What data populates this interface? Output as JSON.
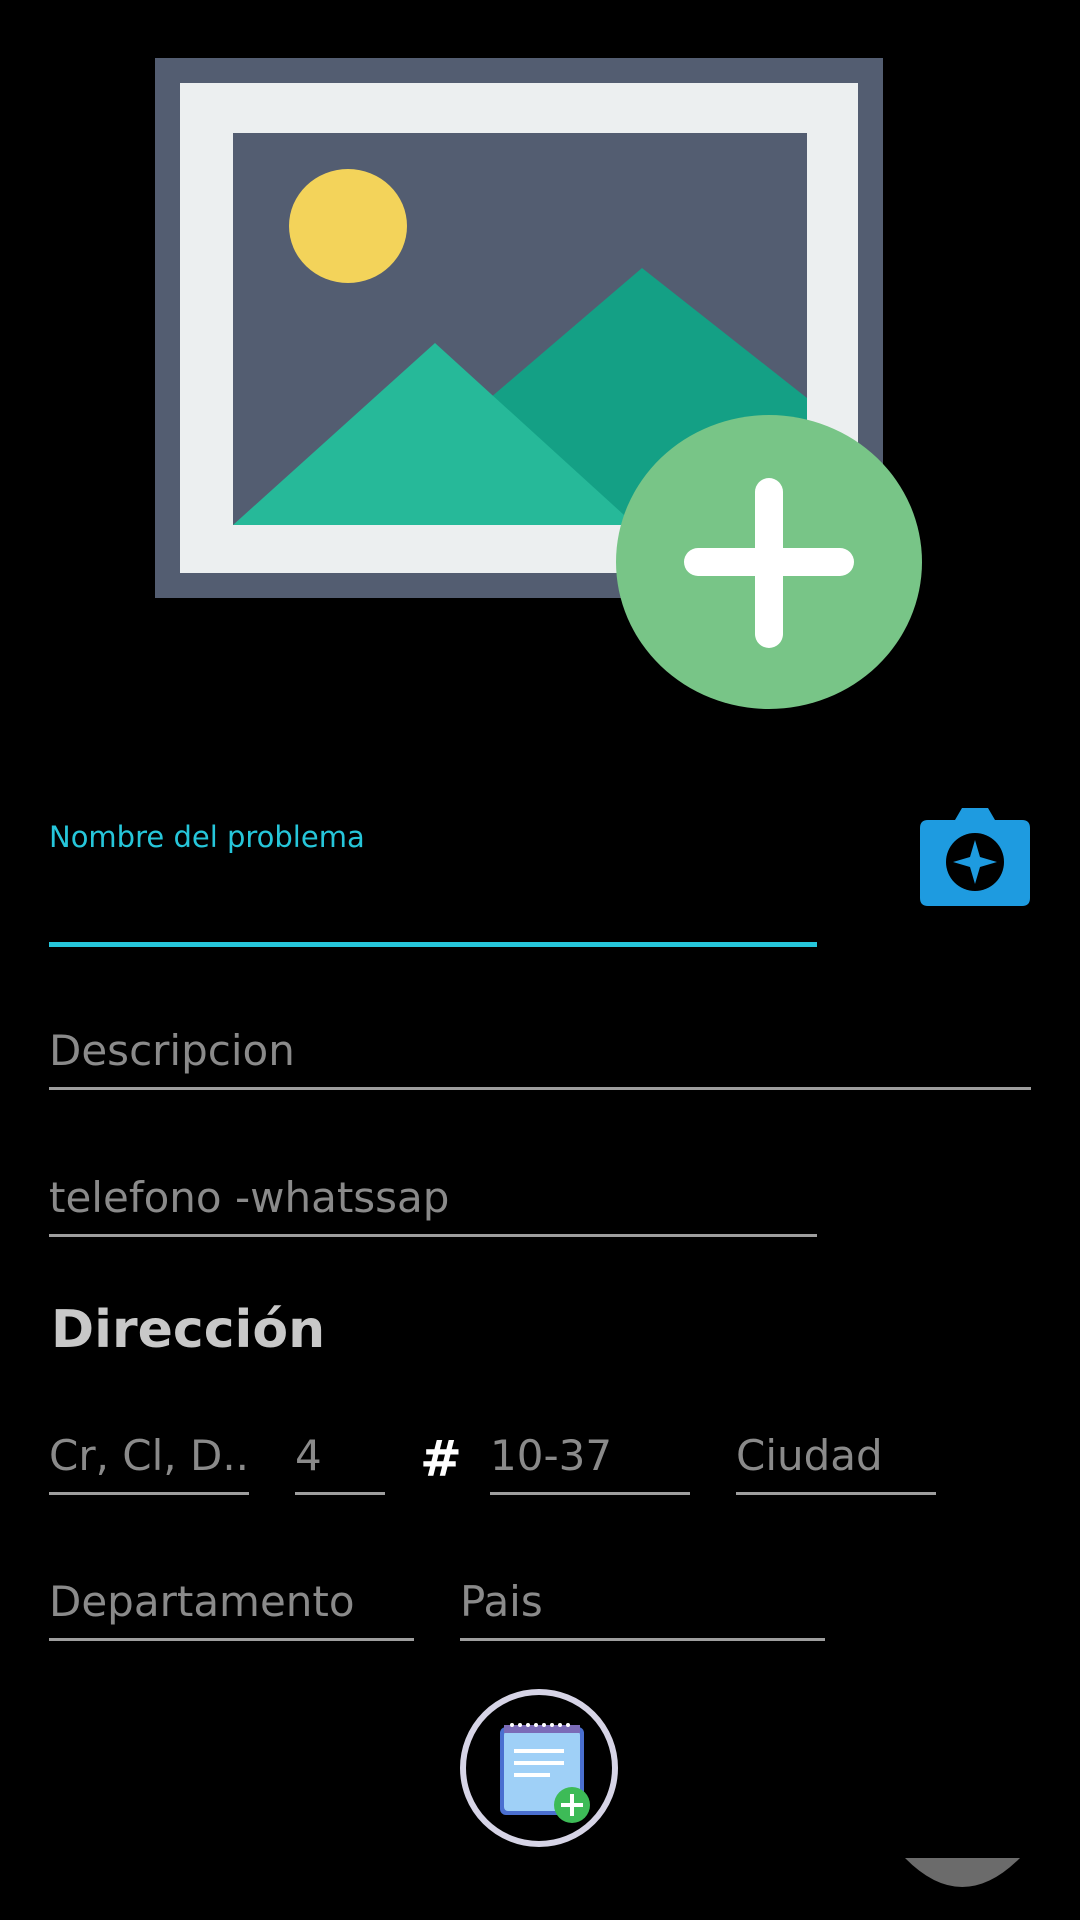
{
  "image_picker": {
    "icon": "add-photo-icon"
  },
  "form": {
    "nombre": {
      "label": "Nombre del problema",
      "value": ""
    },
    "descripcion": {
      "placeholder": "Descripcion",
      "value": ""
    },
    "telefono": {
      "placeholder": "telefono -whatssap",
      "value": ""
    },
    "camera_icon": "camera-icon"
  },
  "direccion": {
    "heading": "Dirección",
    "tipo_via": {
      "placeholder": "Cr, Cl, D..."
    },
    "numero": {
      "placeholder": "4"
    },
    "hash": "#",
    "placa": {
      "placeholder": "10-37"
    },
    "ciudad": {
      "placeholder": "Ciudad"
    },
    "departamento": {
      "placeholder": "Departamento"
    },
    "pais": {
      "placeholder": "Pais"
    }
  },
  "fab": {
    "icon": "add-note-icon"
  },
  "colors": {
    "accent": "#26c6da",
    "camera": "#1e9be0",
    "plus_badge": "#78c587"
  }
}
